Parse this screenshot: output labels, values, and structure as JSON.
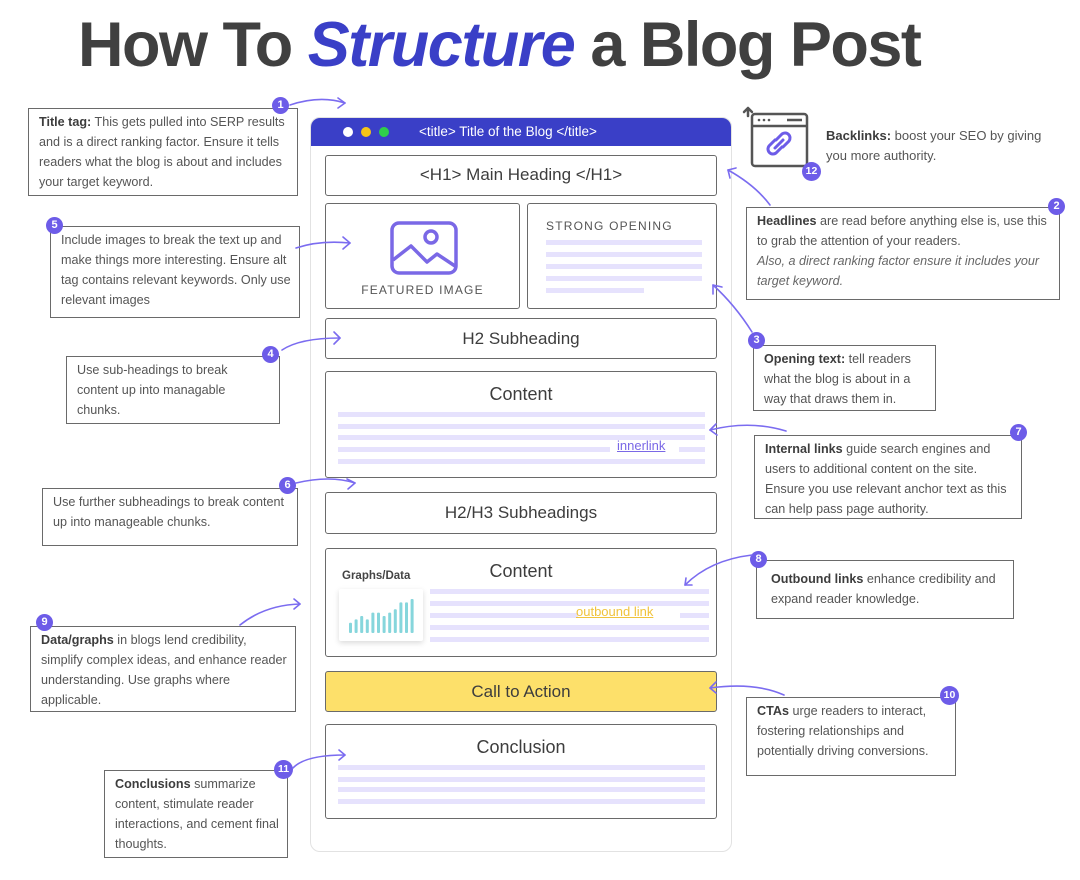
{
  "title": {
    "prefix": "How To ",
    "accent": "Structure",
    "suffix": " a Blog Post",
    "accent_color": "#3a3fc7",
    "text_color": "#404040"
  },
  "colors": {
    "brand_blue": "#3a3fc7",
    "badge_purple": "#6d5ce8",
    "placeholder_line": "#e6e2fd",
    "cta_yellow": "#fde06a",
    "outbound_link": "#f0c33c",
    "chart_bars": "#86d6dc",
    "window_dots": [
      "#ffffff",
      "#f5c518",
      "#2fce4b"
    ]
  },
  "browser": {
    "title_bar_text": "<title> Title of the Blog </title>",
    "blocks": {
      "h1": "<H1> Main Heading </H1>",
      "featured_image": "FEATURED IMAGE",
      "strong_opening": "STRONG OPENING",
      "h2": "H2 Subheading",
      "content1": "Content",
      "innerlink": "innerlink",
      "h2h3": "H2/H3 Subheadings",
      "content2": "Content",
      "graphs_label": "Graphs/Data",
      "outbound_link": "outbound link",
      "cta": "Call to Action",
      "conclusion": "Conclusion"
    }
  },
  "mini_chart": {
    "type": "bar",
    "values": [
      3,
      4,
      5,
      4,
      6,
      6,
      5,
      6,
      7,
      9,
      9,
      10
    ]
  },
  "callouts": {
    "c1": {
      "number": "1",
      "bold": "Title tag:",
      "text": " This gets pulled into SERP results and is a direct ranking factor. Ensure it tells  readers what the blog is about and includes your target keyword."
    },
    "c2": {
      "number": "2",
      "bold": "Headlines",
      "text": " are read before anything else is, use this to grab the attention of your readers.",
      "italic": "Also, a direct ranking factor ensure it includes your target keyword."
    },
    "c3": {
      "number": "3",
      "bold": "Opening text:",
      "text": " tell readers what the blog is about in a way that draws them in."
    },
    "c4": {
      "number": "4",
      "text": "Use sub-headings to break content up into managable chunks."
    },
    "c5": {
      "number": "5",
      "text": "Include images to break the text up and make things more interesting. Ensure alt tag contains relevant keywords.  Only use relevant images"
    },
    "c6": {
      "number": "6",
      "text": "Use further subheadings to break content up into manageable chunks."
    },
    "c7": {
      "number": "7",
      "bold": "Internal links",
      "text": " guide search engines and users to additional content on the site. Ensure you use relevant anchor text as this can help pass page authority."
    },
    "c8": {
      "number": "8",
      "bold": "Outbound links",
      "text": " enhance credibility and expand reader knowledge."
    },
    "c9": {
      "number": "9",
      "bold": "Data/graphs",
      "text": " in blogs lend credibility, simplify complex ideas, and enhance reader understanding. Use graphs where applicable."
    },
    "c10": {
      "number": "10",
      "bold": "CTAs",
      "text": " urge readers to interact, fostering  relationships and potentially driving conversions."
    },
    "c11": {
      "number": "11",
      "bold": "Conclusions",
      "text": " summarize content, stimulate reader interactions, and cement final thoughts."
    },
    "c12": {
      "number": "12",
      "bold": "Backlinks:",
      "text": " boost your SEO by giving you more authority."
    }
  }
}
